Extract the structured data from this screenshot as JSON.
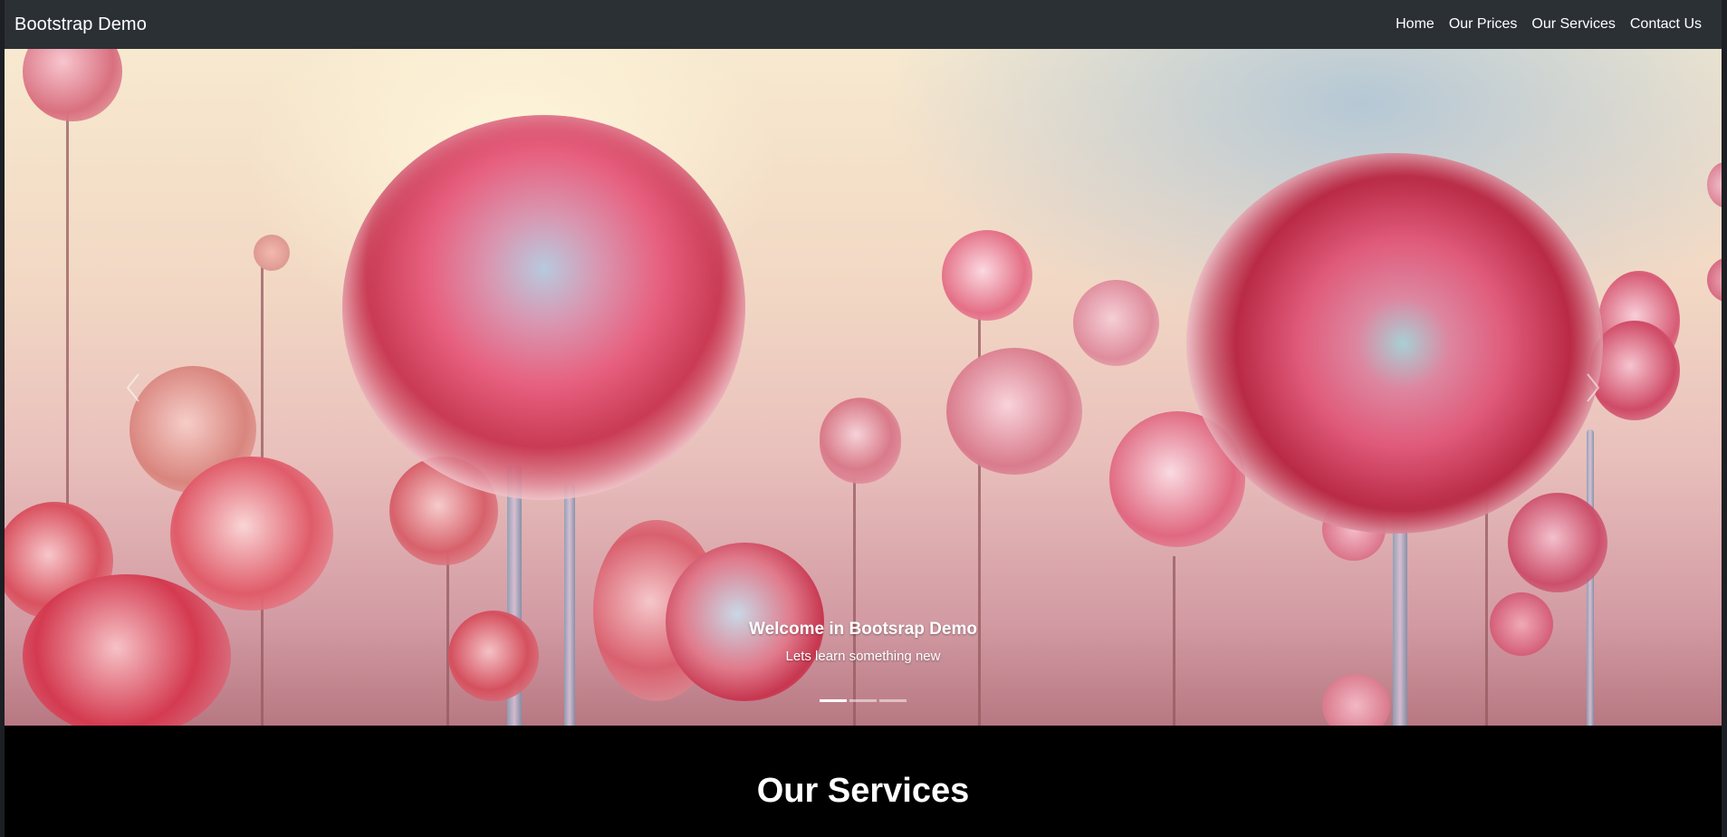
{
  "navbar": {
    "brand": "Bootstrap Demo",
    "links": [
      {
        "label": "Home"
      },
      {
        "label": "Our Prices"
      },
      {
        "label": "Our Services"
      },
      {
        "label": "Contact Us"
      }
    ]
  },
  "carousel": {
    "caption_title": "Welcome in Bootsrap Demo",
    "caption_text": "Lets learn something new",
    "slide_count": 3,
    "active_index": 0,
    "prev_icon": "chevron-left-icon",
    "next_icon": "chevron-right-icon"
  },
  "services": {
    "title": "Our Services"
  },
  "colors": {
    "navbar_bg": "#2b3035",
    "page_bg": "#000000",
    "text": "#ffffff"
  }
}
